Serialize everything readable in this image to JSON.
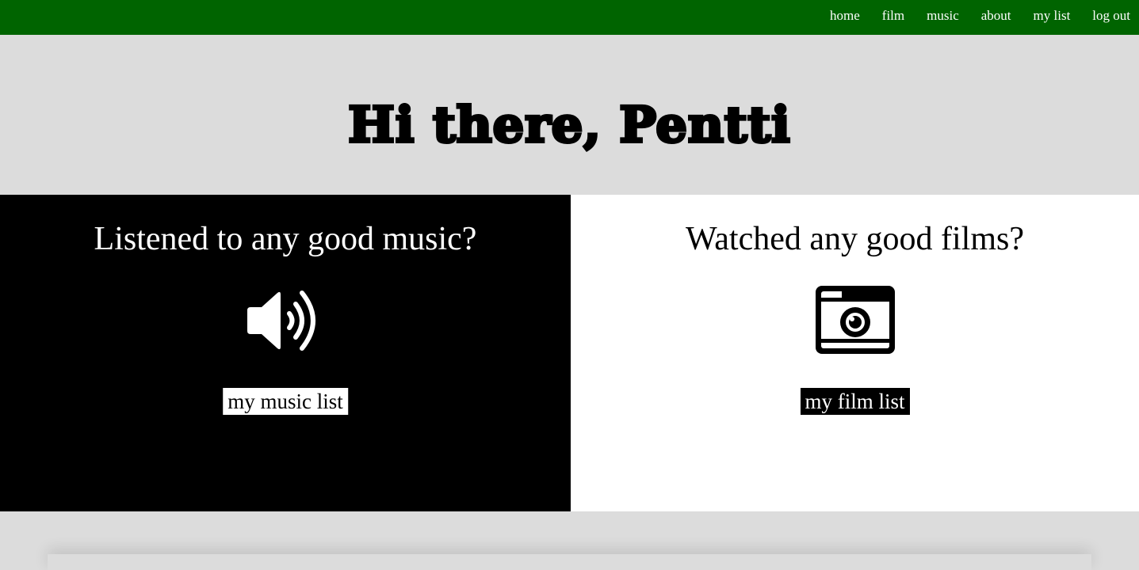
{
  "nav": {
    "items": [
      {
        "label": "home"
      },
      {
        "label": "film"
      },
      {
        "label": "music"
      },
      {
        "label": "about"
      },
      {
        "label": "my list"
      },
      {
        "label": "log out"
      }
    ]
  },
  "hero": {
    "title": "Hi there, Pentti"
  },
  "music": {
    "heading": "Listened to any good music?",
    "icon": "speaker-icon",
    "link_label": "my music list"
  },
  "film": {
    "heading": "Watched any good films?",
    "icon": "camera-icon",
    "link_label": "my film list"
  },
  "colors": {
    "nav_background": "#006400",
    "page_background": "#dcdcdc",
    "music_panel": "#000000",
    "film_panel": "#ffffff"
  }
}
